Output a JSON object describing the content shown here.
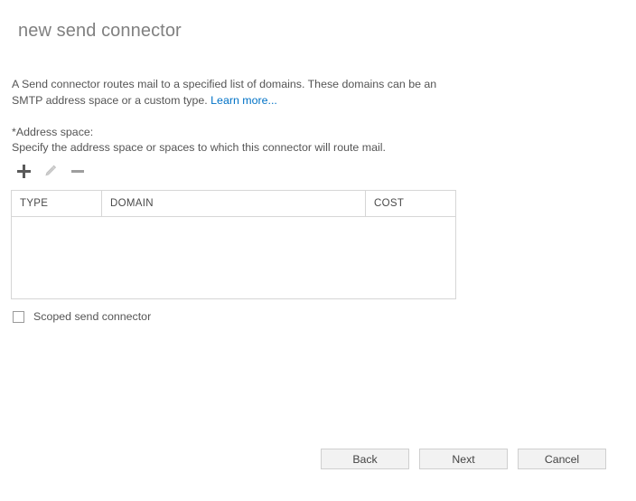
{
  "page": {
    "title": "new send connector"
  },
  "intro": {
    "text_before_link": "A Send connector routes mail to a specified list of domains. These domains can be an SMTP address space or a custom type. ",
    "link_label": "Learn more..."
  },
  "address_space": {
    "label": "*Address space:",
    "hint": "Specify the address space or spaces to which this connector will route mail.",
    "toolbar": [
      {
        "name": "add",
        "icon": "plus-icon",
        "enabled": true
      },
      {
        "name": "edit",
        "icon": "pencil-icon",
        "enabled": false
      },
      {
        "name": "remove",
        "icon": "minus-icon",
        "enabled": true
      }
    ],
    "grid": {
      "columns": [
        "TYPE",
        "DOMAIN",
        "COST"
      ],
      "rows": []
    }
  },
  "scoped": {
    "label": "Scoped send connector",
    "checked": false
  },
  "footer": {
    "buttons": [
      {
        "label": "Back"
      },
      {
        "label": "Next"
      },
      {
        "label": "Cancel"
      }
    ]
  },
  "colors": {
    "link": "#0072c6",
    "title": "#808080",
    "text": "#555555",
    "border": "#d6d6d6",
    "button_bg": "#f2f2f2"
  }
}
